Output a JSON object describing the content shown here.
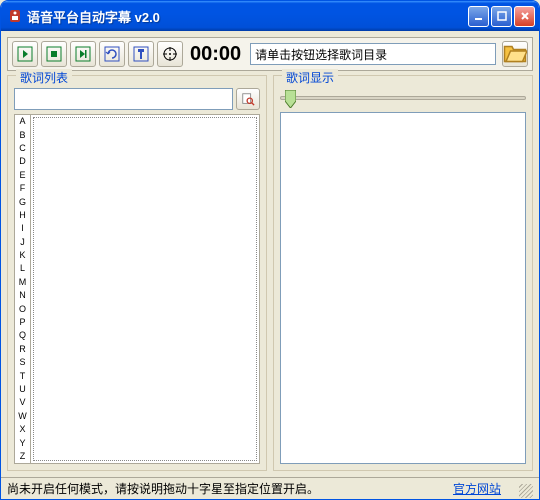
{
  "window": {
    "title": "语音平台自动字幕  v2.0"
  },
  "toolbar": {
    "time": "00:00",
    "path_placeholder": "请单击按钮选择歌词目录"
  },
  "left": {
    "legend": "歌词列表",
    "alpha": [
      "A",
      "B",
      "C",
      "D",
      "E",
      "F",
      "G",
      "H",
      "I",
      "J",
      "K",
      "L",
      "M",
      "N",
      "O",
      "P",
      "Q",
      "R",
      "S",
      "T",
      "U",
      "V",
      "W",
      "X",
      "Y",
      "Z"
    ]
  },
  "right": {
    "legend": "歌词显示"
  },
  "status": {
    "text": "尚未开启任何模式，请按说明拖动十字星至指定位置开启。",
    "link": "官方网站"
  }
}
